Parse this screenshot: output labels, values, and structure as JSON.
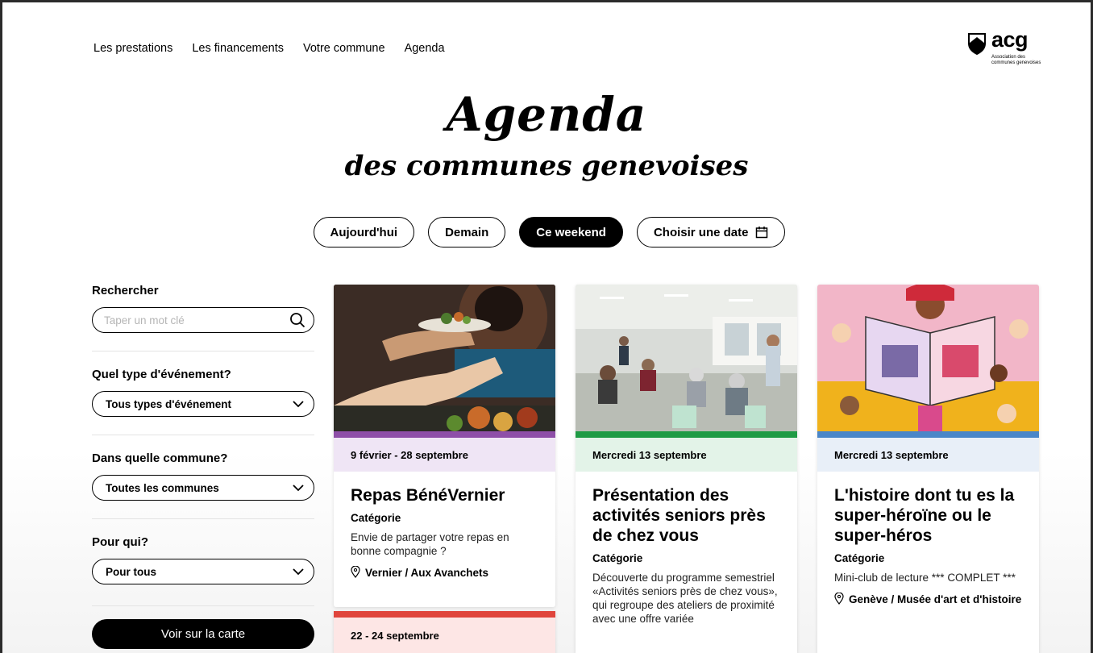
{
  "nav": {
    "items": [
      "Les prestations",
      "Les financements",
      "Votre commune",
      "Agenda"
    ]
  },
  "logo": {
    "word": "acg",
    "subtitle": "Association des communes genevoises",
    "icon": "shield-logo-icon"
  },
  "hero": {
    "title": "Agenda",
    "subtitle": "des communes genevoises"
  },
  "date_filters": [
    {
      "label": "Aujourd'hui",
      "active": false
    },
    {
      "label": "Demain",
      "active": false
    },
    {
      "label": "Ce weekend",
      "active": true
    },
    {
      "label": "Choisir une date",
      "active": false,
      "icon": "calendar-icon"
    }
  ],
  "sidebar": {
    "search_label": "Rechercher",
    "search_placeholder": "Taper un mot clé",
    "search_icon": "search-icon",
    "type_label": "Quel type d'événement?",
    "type_value": "Tous types d'événement",
    "commune_label": "Dans quelle commune?",
    "commune_value": "Toutes les communes",
    "audience_label": "Pour qui?",
    "audience_value": "Pour tous",
    "map_button": "Voir sur la carte"
  },
  "cards": [
    {
      "date": "9 février - 28 septembre",
      "title": "Repas BénéVernier",
      "category": "Catégorie",
      "description": "Envie de partager votre repas en bonne compagnie ?",
      "location": "Vernier / Aux Avanchets",
      "bar_color": "#8e4fa8",
      "date_bg": "#efe5f5"
    },
    {
      "date": "Mercredi 13 septembre",
      "title": "Présentation des activités seniors près de chez vous",
      "category": "Catégorie",
      "description": "Découverte du programme semestriel «Activités seniors près de chez vous», qui regroupe des ateliers de proximité avec une offre variée",
      "bar_color": "#1f9b45",
      "date_bg": "#e3f3e8"
    },
    {
      "date": "Mercredi 13 septembre",
      "title": "L'histoire dont tu es la super-héroïne ou le super-héros",
      "category": "Catégorie",
      "description": "Mini-club de lecture *** COMPLET ***",
      "location": "Genève / Musée d'art et d'histoire",
      "bar_color": "#4a86c8",
      "date_bg": "#e8eff8"
    },
    {
      "date": "22 - 24 septembre",
      "bar_color": "#e0453c",
      "date_bg": "#fde6e5"
    }
  ]
}
